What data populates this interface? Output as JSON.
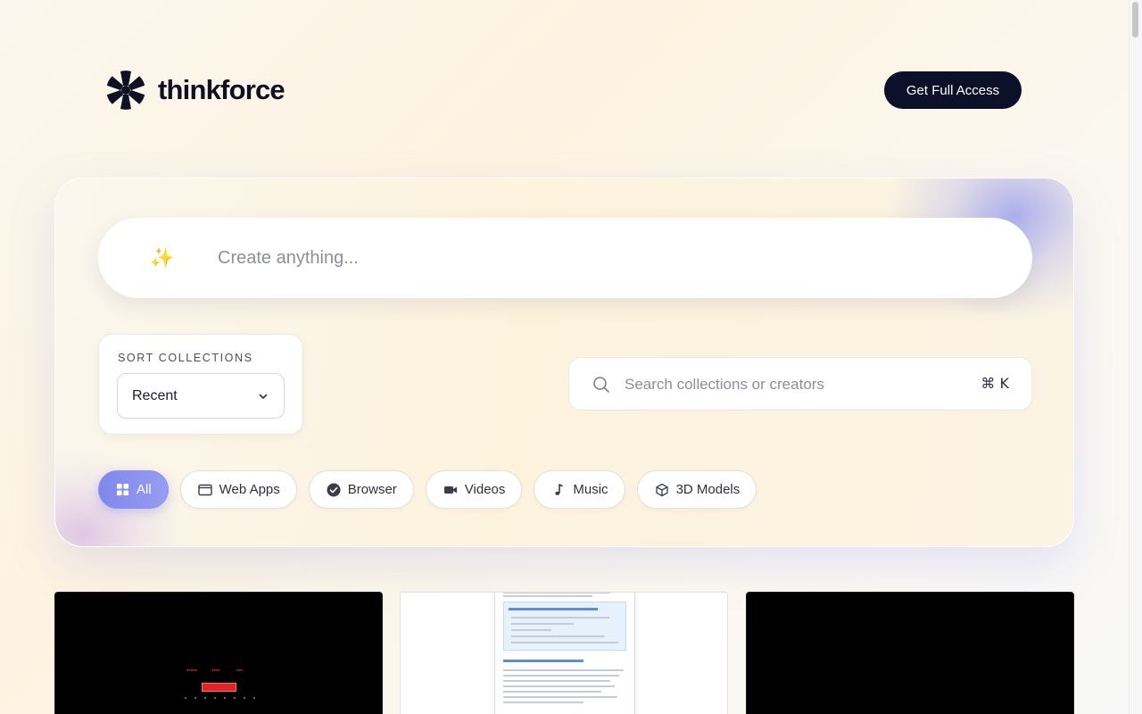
{
  "brand": {
    "name": "thinkforce"
  },
  "header": {
    "cta_label": "Get Full Access"
  },
  "prompt": {
    "placeholder": "Create anything...",
    "icon": "sparkles-icon"
  },
  "sort": {
    "label": "SORT COLLECTIONS",
    "selected": "Recent"
  },
  "search": {
    "placeholder": "Search collections or creators",
    "shortcut": "⌘ K"
  },
  "filters": [
    {
      "label": "All",
      "icon": "grid-icon",
      "active": true
    },
    {
      "label": "Web Apps",
      "icon": "window-icon",
      "active": false
    },
    {
      "label": "Browser",
      "icon": "check-circle-icon",
      "active": false
    },
    {
      "label": "Videos",
      "icon": "video-camera-icon",
      "active": false
    },
    {
      "label": "Music",
      "icon": "music-note-icon",
      "active": false
    },
    {
      "label": "3D Models",
      "icon": "cube-icon",
      "active": false
    }
  ],
  "gallery": {
    "cards": [
      {
        "theme": "dark",
        "preview": "game-screen"
      },
      {
        "theme": "light",
        "preview": "document"
      },
      {
        "theme": "dark",
        "preview": "blank"
      }
    ]
  },
  "colors": {
    "cta_bg": "#0c1028",
    "accent": "#8a91ee",
    "text": "#0f1023"
  }
}
